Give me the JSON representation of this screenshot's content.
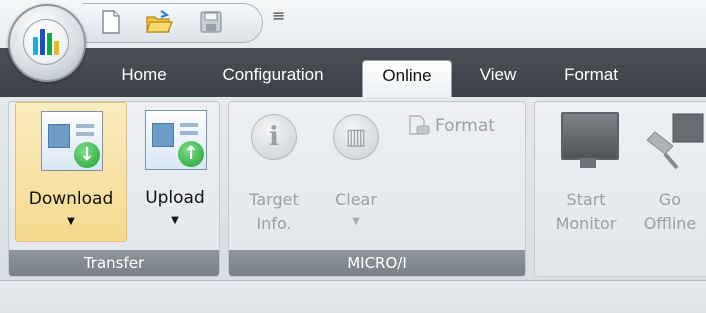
{
  "tabs": [
    {
      "label": "Home"
    },
    {
      "label": "Configuration"
    },
    {
      "label": "Online"
    },
    {
      "label": "View"
    },
    {
      "label": "Format"
    }
  ],
  "active_tab": "Online",
  "groups": {
    "transfer": {
      "label": "Transfer",
      "download": "Download",
      "upload": "Upload"
    },
    "micro": {
      "label": "MICRO/I",
      "target_line1": "Target",
      "target_line2": "Info.",
      "clear": "Clear",
      "format": "Format"
    },
    "monitor": {
      "start_line1": "Start",
      "start_line2": "Monitor",
      "go_line1": "Go",
      "go_line2": "Offline"
    }
  },
  "icons": {
    "new": "new-document-icon",
    "open": "open-folder-icon",
    "save": "save-icon",
    "customize": "customize-quick-access-icon"
  },
  "colors": {
    "tab_bar": "#43484e",
    "highlight": "#f5d98e",
    "group_label_bg": "#7a8088"
  }
}
